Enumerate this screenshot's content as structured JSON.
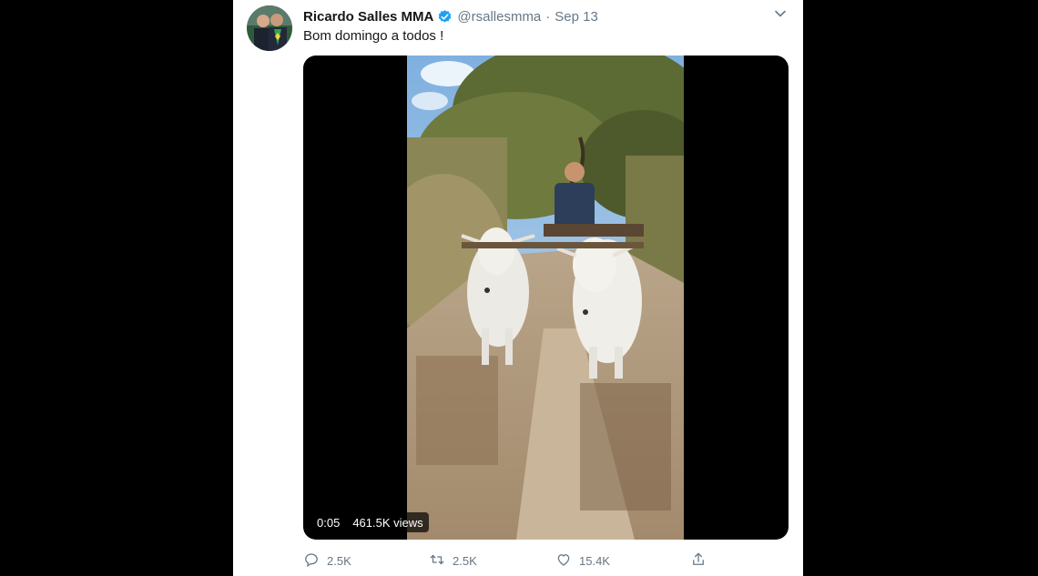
{
  "tweet": {
    "author_name": "Ricardo Salles MMA",
    "handle": "@rsallesmma",
    "separator": "·",
    "date": "Sep 13",
    "text": "Bom domingo a todos !"
  },
  "video": {
    "time": "0:05",
    "views": "461.5K views"
  },
  "actions": {
    "reply_count": "2.5K",
    "retweet_count": "2.5K",
    "like_count": "15.4K"
  },
  "icons": [
    "verified-badge-icon",
    "chevron-down-icon",
    "reply-icon",
    "retweet-icon",
    "like-icon",
    "share-icon"
  ],
  "colors": {
    "accent": "#1da1f2",
    "secondary_text": "#657786",
    "primary_text": "#14171a"
  }
}
